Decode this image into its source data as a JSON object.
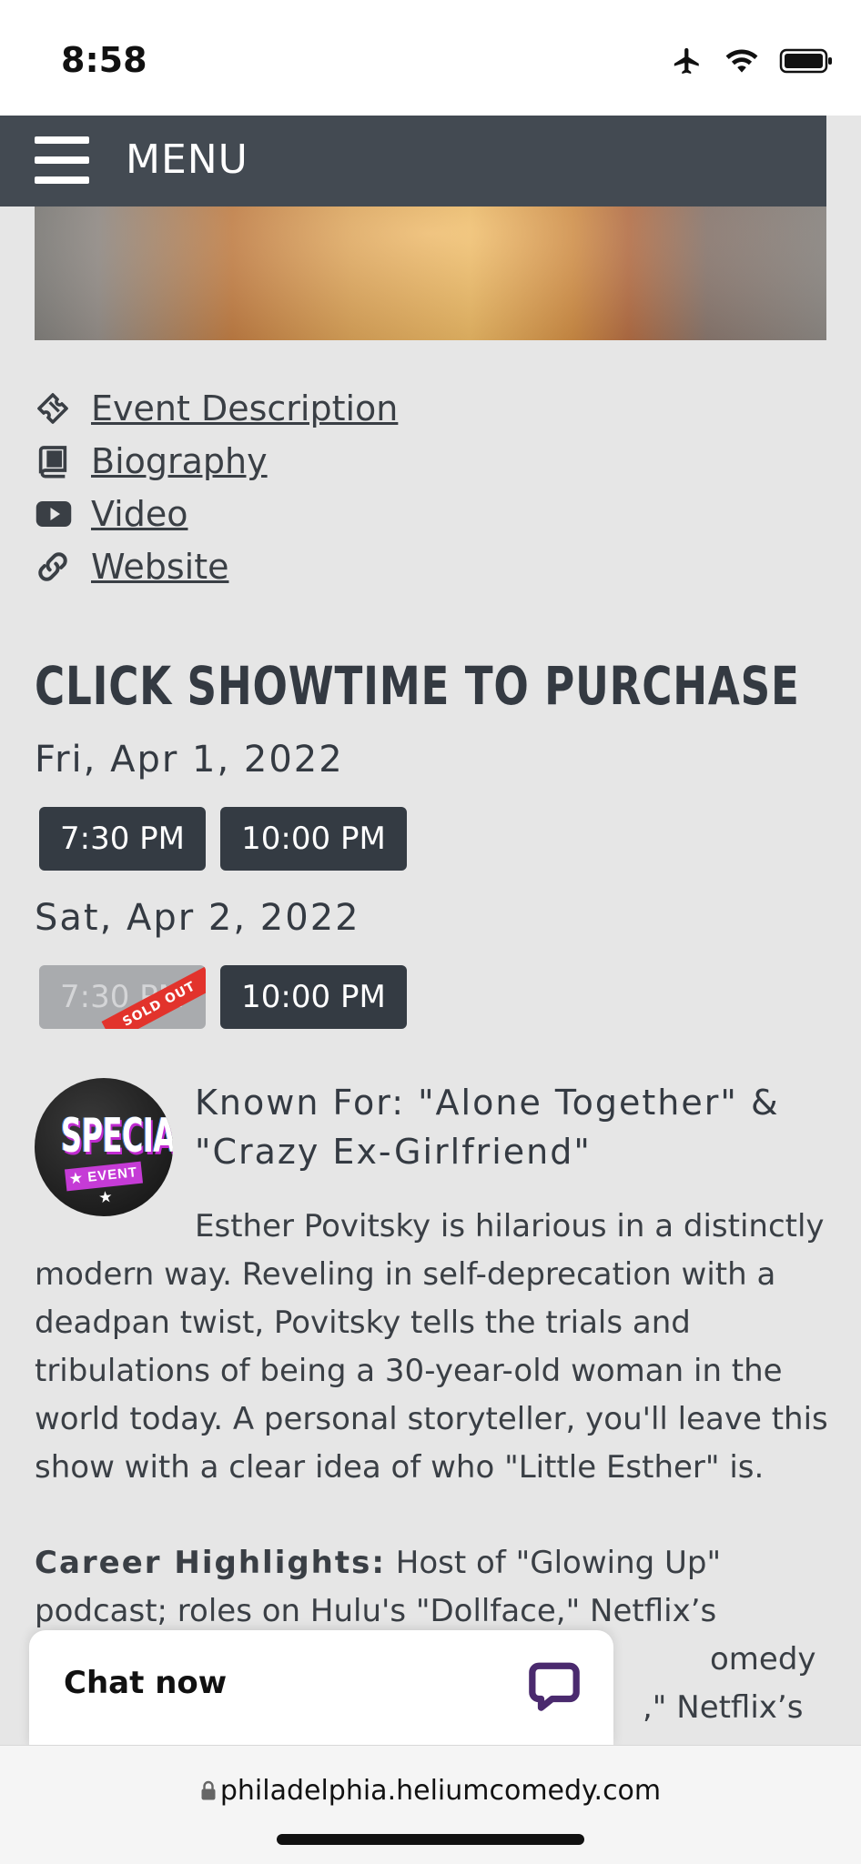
{
  "status_bar": {
    "time": "8:58"
  },
  "nav": {
    "menu_label": "MENU"
  },
  "links": [
    {
      "label": "Event Description",
      "icon": "ticket-icon"
    },
    {
      "label": "Biography",
      "icon": "book-icon"
    },
    {
      "label": "Video",
      "icon": "youtube-icon"
    },
    {
      "label": "Website",
      "icon": "link-icon"
    }
  ],
  "showtimes": {
    "title": "CLICK SHOWTIME TO PURCHASE",
    "days": [
      {
        "date": "Fri, Apr 1, 2022",
        "times": [
          "7:30 PM",
          "10:00 PM"
        ]
      },
      {
        "date": "Sat, Apr 2, 2022",
        "times": [
          "7:30 PM",
          "10:00 PM"
        ],
        "sold_out_label": "SOLD OUT"
      }
    ]
  },
  "badge": {
    "line1": "SPECIAL",
    "line2": "★ EVENT ★"
  },
  "event": {
    "known_for": "Known For: \"Alone Together\" & \"Crazy Ex-Girlfriend\"",
    "bio": "Esther Povitsky is hilarious in a distinctly modern way. Reveling in self-deprecation with a deadpan twist, Povitsky tells the trials and tribulations of being a 30-year-old woman in the world today. A personal storyteller, you'll leave this show with a clear idea of who \"Little Esther\" is.",
    "career_label": "Career Highlights:",
    "career_text": " Host of \"Glowing Up\" podcast; roles on Hulu's \"Dollface,\" Netflix’s",
    "career_line3_fragment": "omedy",
    "career_line4_fragment": ",\" Netflix’s"
  },
  "chat": {
    "label": "Chat now"
  },
  "browser": {
    "url": "philadelphia.heliumcomedy.com"
  },
  "colors": {
    "accent": "#343b43",
    "sold_out": "#e2332c",
    "chat_icon": "#4a2a6e"
  }
}
